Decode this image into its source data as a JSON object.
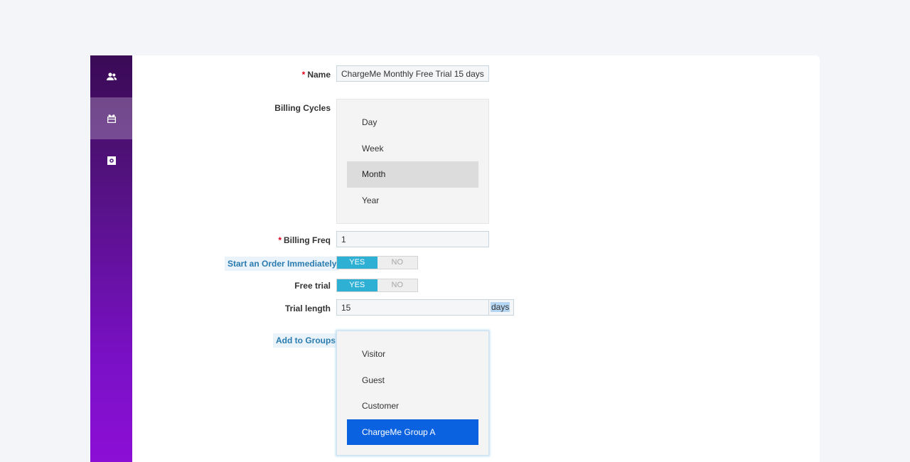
{
  "sidebar": {
    "items": [
      {
        "icon": "users-icon"
      },
      {
        "icon": "gift-card-icon"
      },
      {
        "icon": "settings-icon"
      }
    ]
  },
  "form": {
    "name_label": "Name",
    "name_value": "ChargeMe Monthly Free Trial 15 days",
    "billing_cycles_label": "Billing Cycles",
    "billing_cycles_options": [
      "Day",
      "Week",
      "Month",
      "Year"
    ],
    "billing_cycles_selected": "Month",
    "billing_freq_label": "Billing Freq",
    "billing_freq_value": "1",
    "start_order_label": "Start an Order Immediately",
    "start_order_yes": "YES",
    "start_order_no": "NO",
    "start_order_value": "YES",
    "free_trial_label": "Free trial",
    "free_trial_yes": "YES",
    "free_trial_no": "NO",
    "free_trial_value": "YES",
    "trial_length_label": "Trial length",
    "trial_length_value": "15",
    "trial_length_unit": "days",
    "groups_label": "Add to Groups",
    "groups_options": [
      "Visitor",
      "Guest",
      "Customer",
      "ChargeMe Group A"
    ],
    "groups_selected": "ChargeMe Group A",
    "required_mark": "*"
  },
  "colors": {
    "toggle_on": "#2eb0d4",
    "selected_blue": "#0a62e0",
    "required": "#e4001b",
    "sidebar_top": "#3a0a55",
    "sidebar_bottom": "#8c0fd6"
  }
}
